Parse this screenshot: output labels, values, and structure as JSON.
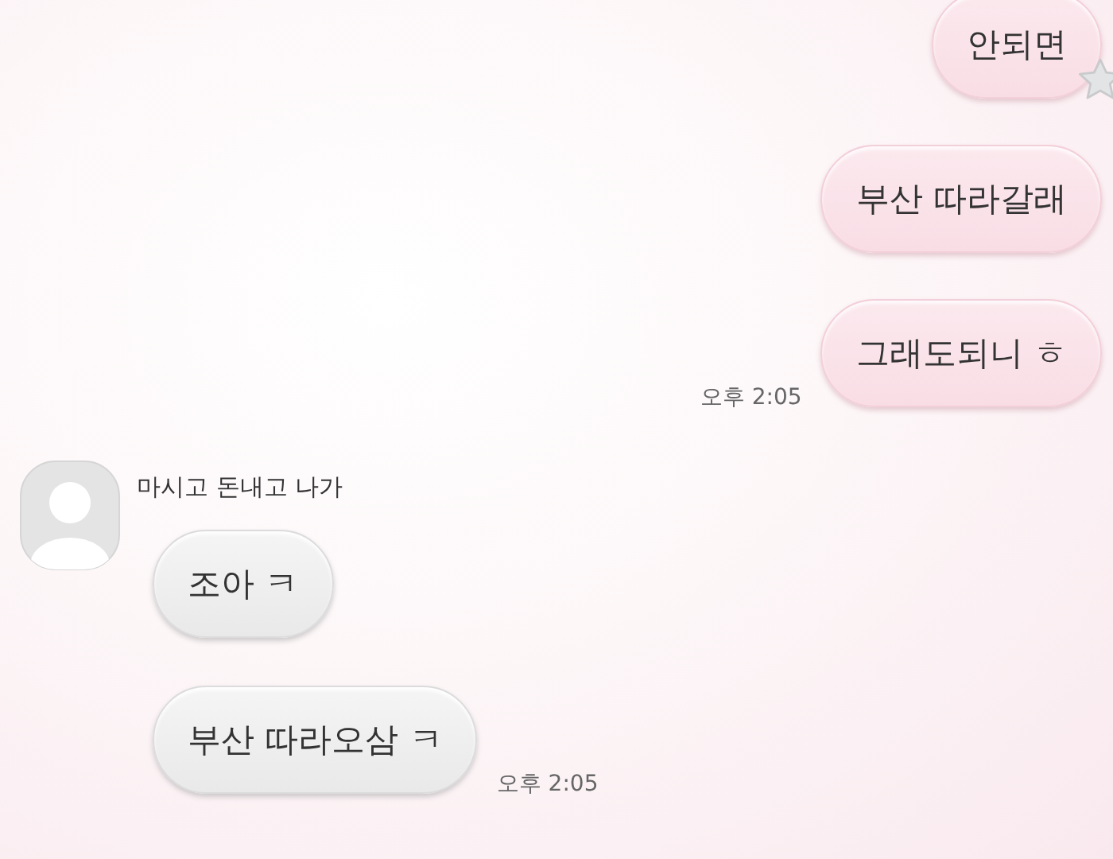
{
  "groups": [
    {
      "kind": "sent",
      "messages": [
        {
          "text": "안되면",
          "reacted": true
        },
        {
          "text": "부산 따라갈래",
          "reacted": false
        },
        {
          "text": "그래도되니 ㅎ",
          "reacted": false
        }
      ],
      "time": "오후 2:05"
    },
    {
      "kind": "received",
      "sender": "마시고 돈내고 나가",
      "messages": [
        {
          "text": "조아 ㅋ",
          "reacted": false
        },
        {
          "text": "부산 따라오삼 ㅋ",
          "reacted": false
        }
      ],
      "time": "오후 2:05"
    }
  ]
}
